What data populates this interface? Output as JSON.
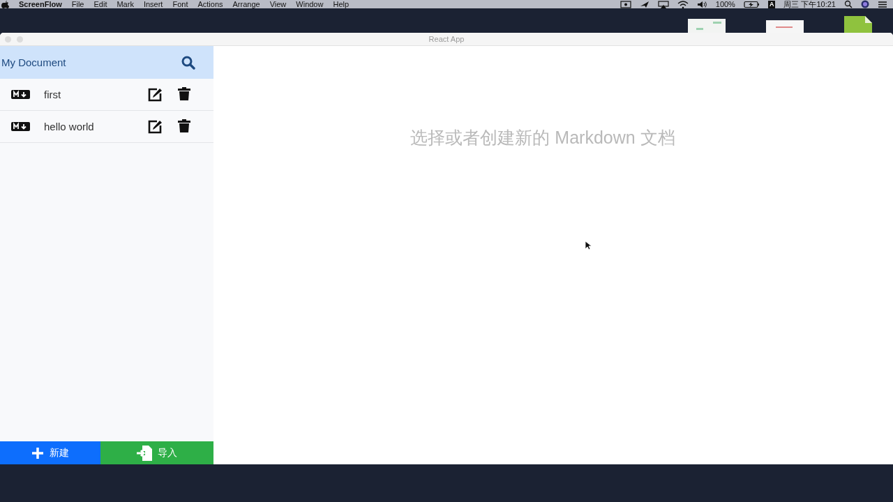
{
  "menu_bar": {
    "app_name": "ScreenFlow",
    "menus": [
      "File",
      "Edit",
      "Mark",
      "Insert",
      "Font",
      "Actions",
      "Arrange",
      "View",
      "Window",
      "Help"
    ],
    "battery": "100%",
    "input_source": "A",
    "clock": "周三 下午10:21"
  },
  "window": {
    "title": "React App"
  },
  "sidebar": {
    "title": "My Document",
    "files": [
      {
        "title": "first"
      },
      {
        "title": "hello world"
      }
    ],
    "buttons": [
      {
        "label": "新建",
        "kind": "new"
      },
      {
        "label": "导入",
        "kind": "import"
      }
    ]
  },
  "editor": {
    "empty_message": "选择或者创建新的 Markdown 文档"
  }
}
